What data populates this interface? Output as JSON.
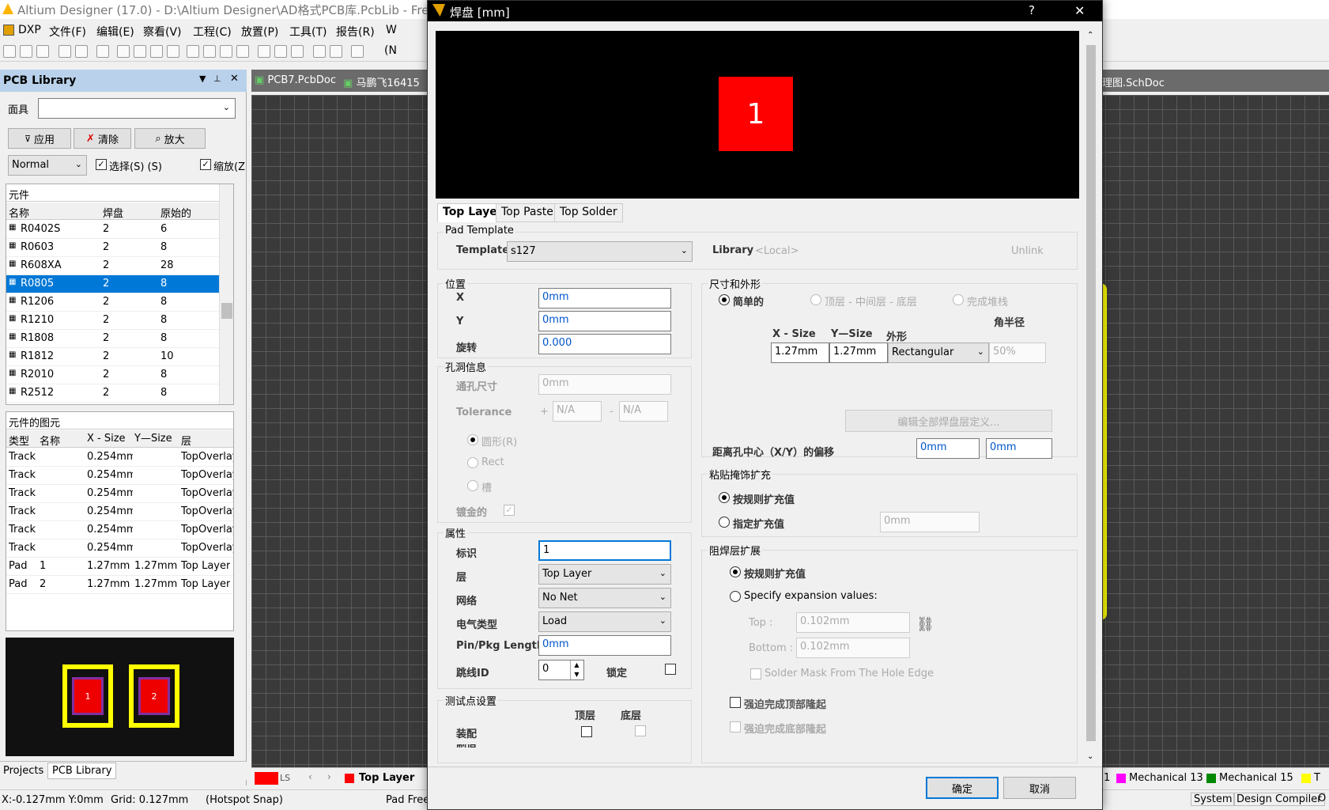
{
  "window": {
    "title": "Altium Designer (17.0) - D:\\Altium Designer\\AD格式PCB库.PcbLib - Free"
  },
  "menu": [
    "DXP",
    "文件(F)",
    "编辑(E)",
    "察看(V)",
    "工程(C)",
    "放置(P)",
    "工具(T)",
    "报告(R)",
    "W"
  ],
  "toolbar": {
    "trailing": "(N"
  },
  "panel": {
    "title": "PCB Library",
    "mask_label": "面具",
    "buttons": [
      "应用",
      "清除",
      "放大"
    ],
    "mode": "Normal",
    "select_label": "选择(S) (S)",
    "zoom_label": "缩放(Z",
    "components": {
      "title": "元件",
      "headers": [
        "名称",
        "焊盘",
        "原始的"
      ],
      "rows": [
        [
          "R0402S",
          "2",
          "6"
        ],
        [
          "R0603",
          "2",
          "8"
        ],
        [
          "R608XA",
          "2",
          "28"
        ],
        [
          "R0805",
          "2",
          "8"
        ],
        [
          "R1206",
          "2",
          "8"
        ],
        [
          "R1210",
          "2",
          "8"
        ],
        [
          "R1808",
          "2",
          "8"
        ],
        [
          "R1812",
          "2",
          "10"
        ],
        [
          "R2010",
          "2",
          "8"
        ],
        [
          "R2512",
          "2",
          "8"
        ]
      ],
      "selected": 3
    },
    "primitives": {
      "title": "元件的图元",
      "headers": [
        "类型",
        "名称",
        "X - Size",
        "Y—Size",
        "层"
      ],
      "rows": [
        [
          "Track",
          "",
          "0.254mm",
          "",
          "TopOverlay"
        ],
        [
          "Track",
          "",
          "0.254mm",
          "",
          "TopOverlay"
        ],
        [
          "Track",
          "",
          "0.254mm",
          "",
          "TopOverlay"
        ],
        [
          "Track",
          "",
          "0.254mm",
          "",
          "TopOverlay"
        ],
        [
          "Track",
          "",
          "0.254mm",
          "",
          "TopOverlay"
        ],
        [
          "Track",
          "",
          "0.254mm",
          "",
          "TopOverlay"
        ],
        [
          "Pad",
          "1",
          "1.27mm",
          "1.27mm",
          "Top Layer"
        ],
        [
          "Pad",
          "2",
          "1.27mm",
          "1.27mm",
          "Top Layer"
        ]
      ]
    },
    "preview": {
      "pad1": "1",
      "pad2": "2"
    },
    "tabs": [
      "Projects",
      "PCB Library"
    ]
  },
  "doc_tabs": [
    "PCB7.PcbDoc",
    "马鹏飞16415",
    "理图.SchDoc"
  ],
  "layers": {
    "current": "Top Layer",
    "ls": "LS",
    "right": [
      "Mechanical 13",
      "Mechanical 15",
      "T"
    ],
    "right_prefix": "1"
  },
  "status": {
    "coords": "X:-0.127mm Y:0mm",
    "grid": "Grid: 0.127mm",
    "snap": "(Hotspot Snap)",
    "pad": "Pad Free",
    "system": "System",
    "compiler": "Design Compiler",
    "o": "O"
  },
  "dialog": {
    "title": "焊盘 [mm]",
    "help": "?",
    "close": "✕",
    "preview_pad": "1",
    "tabs": [
      "Top Layer",
      "Top Paste",
      "Top Solder"
    ],
    "template": {
      "group": "Pad Template",
      "label": "Template",
      "value": "s127",
      "library_label": "Library",
      "library_value": "<Local>",
      "unlink": "Unlink"
    },
    "position": {
      "group": "位置",
      "x_label": "X",
      "x": "0mm",
      "y_label": "Y",
      "y": "0mm",
      "rot_label": "旋转",
      "rot": "0.000"
    },
    "hole": {
      "group": "孔洞信息",
      "size_label": "通孔尺寸",
      "size": "0mm",
      "tol_label": "Tolerance",
      "plus": "+",
      "minus": "-",
      "tol_plus": "N/A",
      "tol_minus": "N/A",
      "round": "圆形(R)",
      "rect": "Rect",
      "slot": "槽",
      "plated": "镀金的"
    },
    "props": {
      "group": "属性",
      "id_label": "标识",
      "id": "1",
      "layer_label": "层",
      "layer": "Top Layer",
      "net_label": "网络",
      "net": "No Net",
      "etype_label": "电气类型",
      "etype": "Load",
      "pinlen_label": "Pin/Pkg Length",
      "pinlen": "0mm",
      "jumper_label": "跳线ID",
      "jumper": "0",
      "lock_label": "锁定"
    },
    "testpoint": {
      "group": "测试点设置",
      "top": "顶层",
      "bottom": "底层",
      "assembly": "装配",
      "fab": "制造"
    },
    "size": {
      "group": "尺寸和外形",
      "simple": "简单的",
      "tmb": "顶层 - 中间层 - 底层",
      "full": "完成堆栈",
      "corner": "角半径",
      "xs": "X - Size",
      "ys": "Y—Size",
      "shape_label": "外形",
      "xv": "1.27mm",
      "yv": "1.27mm",
      "shape": "Rectangular",
      "pct": "50%",
      "edit_btn": "编辑全部焊盘层定义...",
      "offset_label": "距离孔中心（X/Y）的偏移",
      "ox": "0mm",
      "oy": "0mm"
    },
    "paste": {
      "group": "粘贴掩饰扩充",
      "rule": "按规则扩充值",
      "specify": "指定扩充值",
      "value": "0mm"
    },
    "solder": {
      "group": "阻焊层扩展",
      "rule": "按规则扩充值",
      "specify": "Specify expansion values:",
      "top_label": "Top :",
      "top": "0.102mm",
      "bottom_label": "Bottom :",
      "bottom": "0.102mm",
      "from_hole": "Solder Mask From The Hole Edge",
      "force_top": "强迫完成顶部隆起",
      "force_bottom": "强迫完成底部隆起"
    },
    "ok": "确定",
    "cancel": "取消"
  }
}
